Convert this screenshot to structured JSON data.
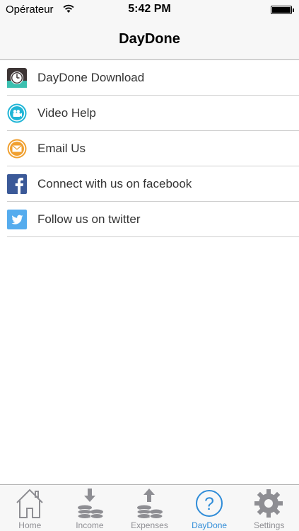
{
  "status_bar": {
    "carrier": "Opérateur",
    "time": "5:42 PM"
  },
  "nav": {
    "title": "DayDone"
  },
  "menu": {
    "items": [
      {
        "label": "DayDone Download",
        "icon": "clock-icon"
      },
      {
        "label": "Video Help",
        "icon": "video-camera-icon"
      },
      {
        "label": "Email Us",
        "icon": "envelope-icon"
      },
      {
        "label": "Connect with us on facebook",
        "icon": "facebook-icon"
      },
      {
        "label": "Follow us on twitter",
        "icon": "twitter-icon"
      }
    ]
  },
  "tab_bar": {
    "active": "DayDone",
    "tabs": [
      {
        "label": "Home",
        "icon": "house-icon"
      },
      {
        "label": "Income",
        "icon": "coins-down-arrow-icon"
      },
      {
        "label": "Expenses",
        "icon": "coins-up-arrow-icon"
      },
      {
        "label": "DayDone",
        "icon": "question-mark-icon"
      },
      {
        "label": "Settings",
        "icon": "gear-icon"
      }
    ]
  },
  "colors": {
    "accent": "#2f8cd8",
    "tab_inactive": "#8e8e93",
    "facebook": "#3b5998",
    "twitter": "#55acee",
    "video": "#1fb5d6",
    "email": "#f0a030",
    "clock_teal": "#3cc0b0"
  }
}
